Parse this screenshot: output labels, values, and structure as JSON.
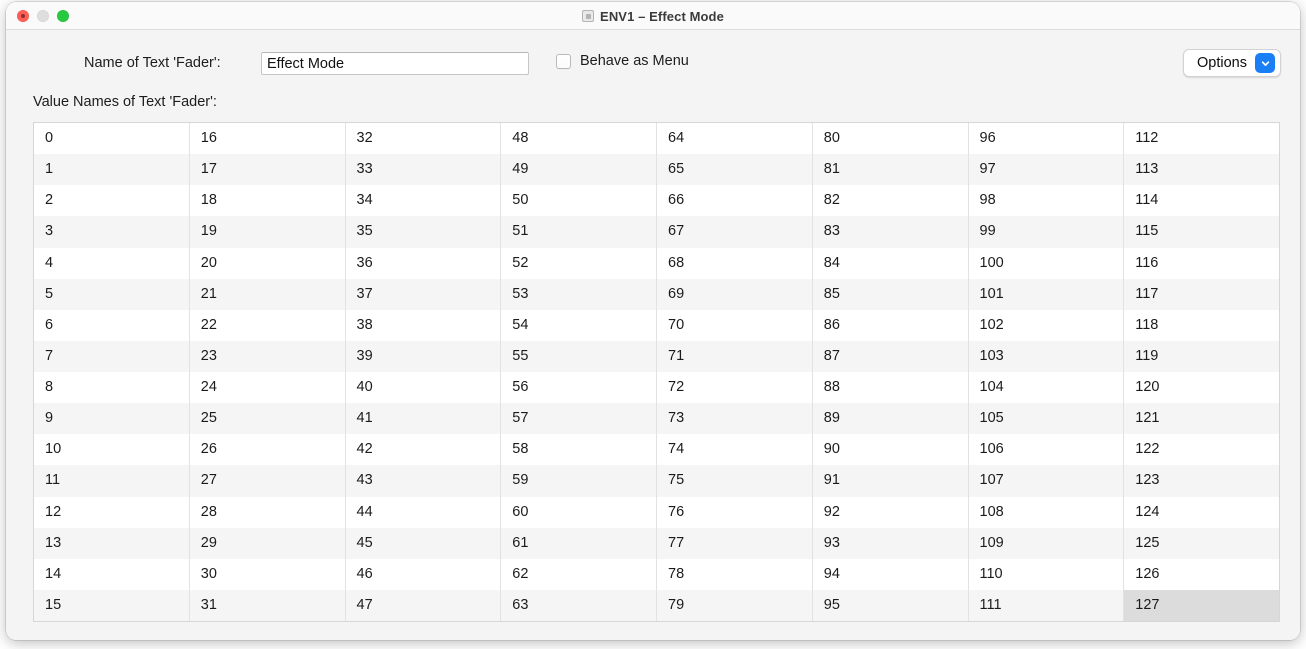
{
  "window": {
    "title": "ENV1 – Effect Mode",
    "title_icon": "window-document-icon",
    "traffic_lights": [
      {
        "name": "close",
        "color": "#ff5f57"
      },
      {
        "name": "minimize",
        "color": "#dedede"
      },
      {
        "name": "maximize",
        "color": "#28c840"
      }
    ]
  },
  "form": {
    "fader_name_label": "Name of Text 'Fader':",
    "fader_name_value": "Effect Mode",
    "fader_name_placeholder": "",
    "behave_as_menu_label": "Behave as Menu",
    "behave_as_menu_checked": false,
    "options_label": "Options",
    "options_chevron_icon": "chevron-down-icon",
    "options_accent_color": "#1a7ef5"
  },
  "table": {
    "caption": "Value Names of Text 'Fader':",
    "rows_per_column": 16,
    "selected_value": "127",
    "columns": [
      {
        "values": [
          "0",
          "1",
          "2",
          "3",
          "4",
          "5",
          "6",
          "7",
          "8",
          "9",
          "10",
          "11",
          "12",
          "13",
          "14",
          "15"
        ]
      },
      {
        "values": [
          "16",
          "17",
          "18",
          "19",
          "20",
          "21",
          "22",
          "23",
          "24",
          "25",
          "26",
          "27",
          "28",
          "29",
          "30",
          "31"
        ]
      },
      {
        "values": [
          "32",
          "33",
          "34",
          "35",
          "36",
          "37",
          "38",
          "39",
          "40",
          "41",
          "42",
          "43",
          "44",
          "45",
          "46",
          "47"
        ]
      },
      {
        "values": [
          "48",
          "49",
          "50",
          "51",
          "52",
          "53",
          "54",
          "55",
          "56",
          "57",
          "58",
          "59",
          "60",
          "61",
          "62",
          "63"
        ]
      },
      {
        "values": [
          "64",
          "65",
          "66",
          "67",
          "68",
          "69",
          "70",
          "71",
          "72",
          "73",
          "74",
          "75",
          "76",
          "77",
          "78",
          "79"
        ]
      },
      {
        "values": [
          "80",
          "81",
          "82",
          "83",
          "84",
          "85",
          "86",
          "87",
          "88",
          "89",
          "90",
          "91",
          "92",
          "93",
          "94",
          "95"
        ]
      },
      {
        "values": [
          "96",
          "97",
          "98",
          "99",
          "100",
          "101",
          "102",
          "103",
          "104",
          "105",
          "106",
          "107",
          "108",
          "109",
          "110",
          "111"
        ]
      },
      {
        "values": [
          "112",
          "113",
          "114",
          "115",
          "116",
          "117",
          "118",
          "119",
          "120",
          "121",
          "122",
          "123",
          "124",
          "125",
          "126",
          "127"
        ]
      }
    ]
  }
}
